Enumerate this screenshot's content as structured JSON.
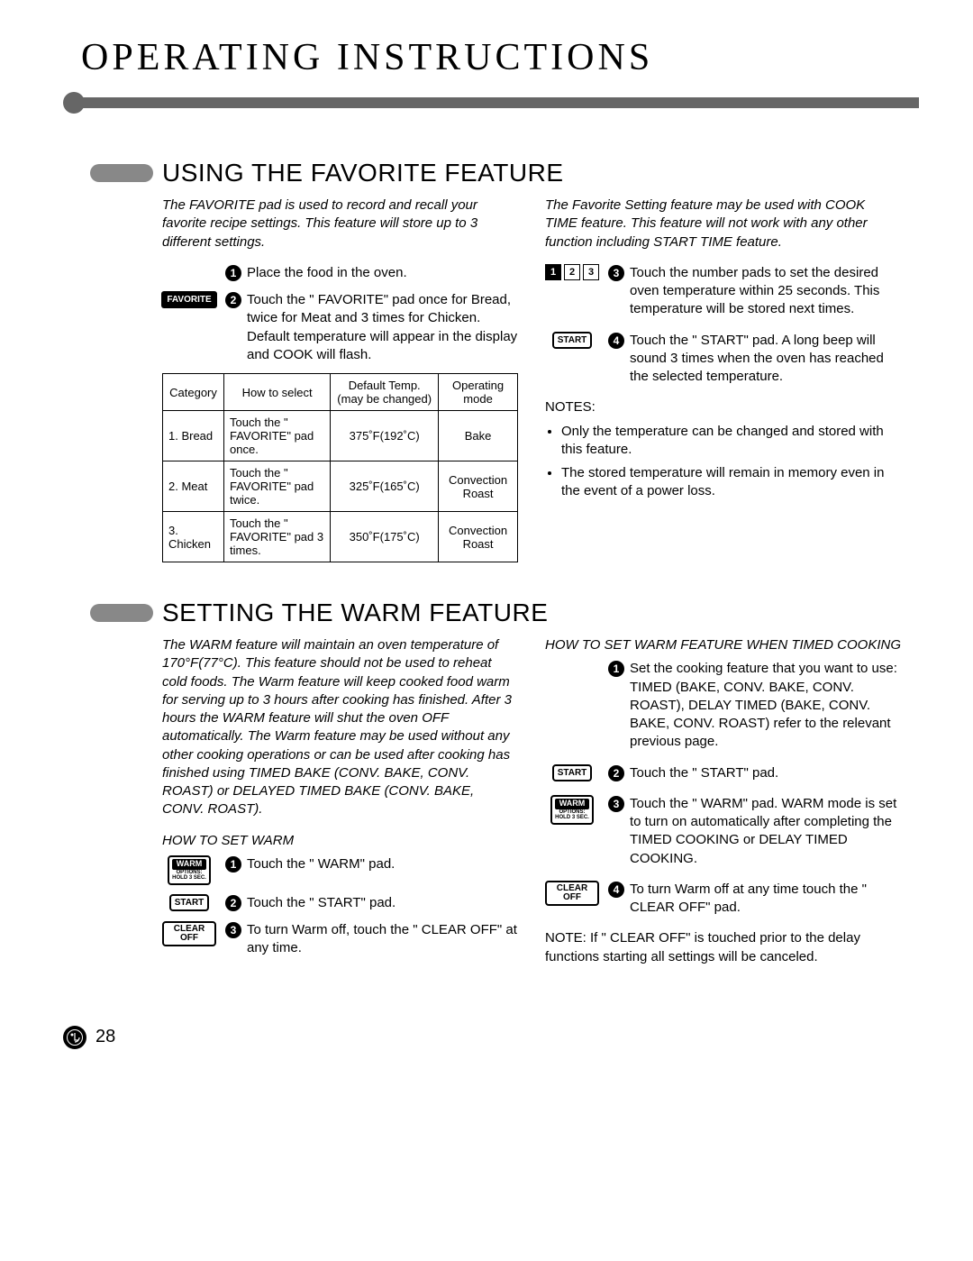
{
  "page": {
    "title": "OPERATING INSTRUCTIONS",
    "number": "28"
  },
  "favorite": {
    "heading": "USING THE FAVORITE FEATURE",
    "intro_left": "The  FAVORITE    pad is used to record and recall your favorite recipe settings. This feature will store up to 3 different settings.",
    "intro_right": "The Favorite Setting feature may be used with COOK TIME feature. This feature will not work with any other function including START TIME feature.",
    "pad_label_favorite": "FAVORITE",
    "pad_label_start": "START",
    "left_steps": {
      "s1": "Place the food in the oven.",
      "s2": "Touch the \" FAVORITE\"  pad once for Bread, twice for Meat and 3 times for Chicken. Default temperature will appear in the display and COOK will flash."
    },
    "right_steps": {
      "s3": "Touch the number pads to set the desired oven temperature within 25 seconds. This temperature will be stored next times.",
      "s4": "Touch the \" START\"  pad. A long beep will sound 3 times when the oven has reached the selected temperature."
    },
    "numkeys": {
      "k1": "1",
      "k2": "2",
      "k3": "3"
    },
    "notes_heading": "NOTES:",
    "notes": {
      "n1": "Only the temperature can be changed and stored with this feature.",
      "n2": "The stored temperature will remain in memory even in the event of a power loss."
    },
    "table": {
      "headers": {
        "c1": "Category",
        "c2": "How to select",
        "c3": "Default Temp. (may be changed)",
        "c4": "Operating mode"
      },
      "rows": [
        {
          "c1": "1. Bread",
          "c2": "Touch the \" FAVORITE\" pad once.",
          "c3": "375˚F(192˚C)",
          "c4": "Bake"
        },
        {
          "c1": "2. Meat",
          "c2": "Touch the \" FAVORITE\" pad twice.",
          "c3": "325˚F(165˚C)",
          "c4": "Convection Roast"
        },
        {
          "c1": "3. Chicken",
          "c2": "Touch the \" FAVORITE\" pad 3 times.",
          "c3": "350˚F(175˚C)",
          "c4": "Convection Roast"
        }
      ]
    }
  },
  "warm": {
    "heading": "SETTING THE WARM FEATURE",
    "intro": "The WARM feature will maintain an oven temperature of 170°F(77°C). This feature should not be used to reheat cold foods. The Warm feature will keep cooked food warm for serving up to 3 hours after cooking has finished. After 3 hours the WARM feature will shut the oven OFF automatically. The Warm feature may be used without any other cooking operations or can be used after cooking has finished using TIMED BAKE (CONV. BAKE, CONV. ROAST) or DELAYED TIMED BAKE (CONV. BAKE, CONV. ROAST).",
    "sub_left": "HOW TO SET WARM",
    "sub_right": "HOW TO SET WARM FEATURE WHEN TIMED COOKING",
    "pad_label_start": "START",
    "pad_label_clear": "CLEAR OFF",
    "pad_warm_top": "WARM",
    "pad_warm_mid": "OPTIONS:",
    "pad_warm_bot": "HOLD 3 SEC.",
    "left_steps": {
      "s1": "Touch the \" WARM\"  pad.",
      "s2": "Touch the \" START\"  pad.",
      "s3": "To turn Warm off, touch the \" CLEAR OFF\"  at any time."
    },
    "right_steps": {
      "s1": "Set the cooking feature that you want to use: TIMED (BAKE, CONV. BAKE, CONV. ROAST), DELAY TIMED (BAKE, CONV. BAKE, CONV. ROAST) refer to the relevant previous page.",
      "s2": "Touch the \" START\"  pad.",
      "s3": "Touch the \" WARM\"  pad. WARM mode is set to turn on automatically after completing the TIMED COOKING or DELAY TIMED COOKING.",
      "s4": "To turn Warm off at any time touch the \" CLEAR OFF\"  pad."
    },
    "note_line": "NOTE: If \" CLEAR OFF\"  is touched prior to the delay functions starting all settings will be canceled."
  }
}
